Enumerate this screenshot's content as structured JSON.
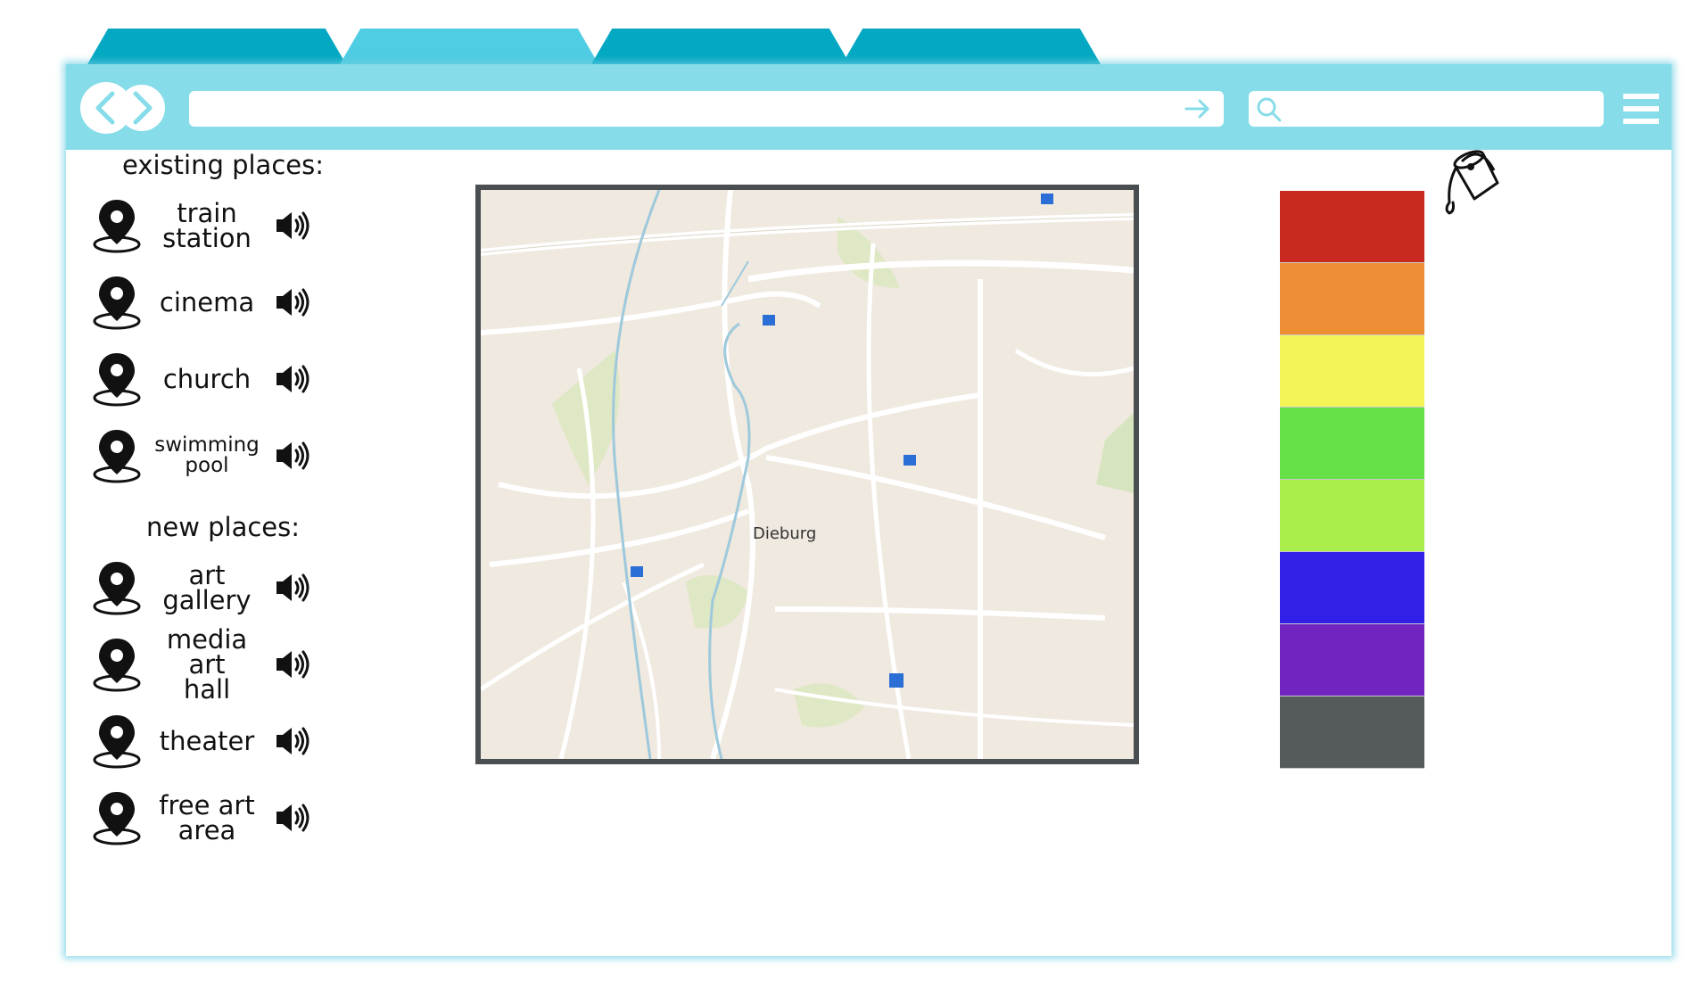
{
  "tabs": [
    {
      "name": "tab-1",
      "color": "#04a8c2"
    },
    {
      "name": "tab-2",
      "color": "#4fcde3"
    },
    {
      "name": "tab-3",
      "color": "#04a8c2"
    },
    {
      "name": "tab-4",
      "color": "#04a8c2"
    }
  ],
  "toolbar": {
    "url_value": "",
    "search_value": ""
  },
  "sidebar": {
    "existing_title": "existing places:",
    "new_title": "new places:",
    "existing_places": [
      {
        "line1": "train",
        "line2": "station"
      },
      {
        "line1": "cinema",
        "line2": ""
      },
      {
        "line1": "church",
        "line2": ""
      },
      {
        "line1": "swimming",
        "line2": "pool"
      }
    ],
    "new_places": [
      {
        "line1": "art",
        "line2": "gallery"
      },
      {
        "line1": "media art",
        "line2": "hall"
      },
      {
        "line1": "theater",
        "line2": ""
      },
      {
        "line1": "free art",
        "line2": "area"
      }
    ]
  },
  "map": {
    "city_label": "Dieburg"
  },
  "palette": [
    "#c92a1f",
    "#ee8f35",
    "#f4f457",
    "#66e047",
    "#abed4a",
    "#3320e8",
    "#7224c0",
    "#555b5c"
  ]
}
